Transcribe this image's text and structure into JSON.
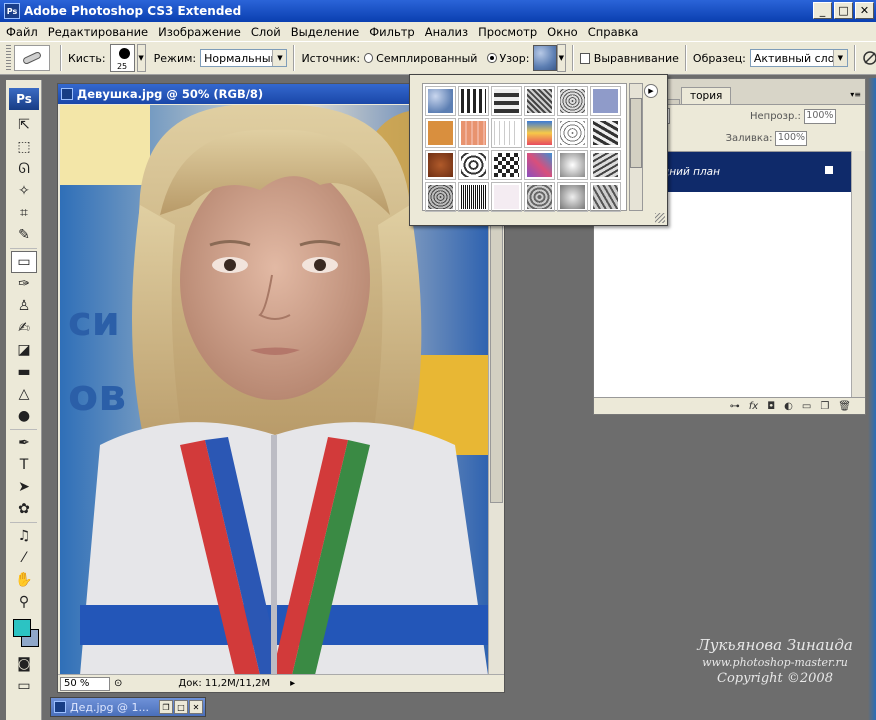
{
  "window": {
    "title": "Adobe Photoshop CS3 Extended",
    "app_icon": "Ps",
    "controls": [
      "_",
      "□",
      "✕"
    ]
  },
  "menu": [
    "Файл",
    "Редактирование",
    "Изображение",
    "Слой",
    "Выделение",
    "Фильтр",
    "Анализ",
    "Просмотр",
    "Окно",
    "Справка"
  ],
  "options": {
    "brush_label": "Кисть:",
    "brush_size": "25",
    "mode_label": "Режим:",
    "mode_value": "Нормальный",
    "source_label": "Источник:",
    "source_sampled": "Семплированный",
    "source_pattern": "Узор:",
    "aligned_label": "Выравнивание",
    "sample_label": "Образец:",
    "sample_value": "Активный слой"
  },
  "toolbox": {
    "logo": "Ps"
  },
  "document": {
    "title": "Девушка.jpg @ 50% (RGB/8)",
    "zoom": "50 %",
    "doc_info": "Док: 11,2M/11,2M"
  },
  "layers_panel": {
    "tab_history": "тория",
    "opacity_label": "Непрозр.:",
    "opacity_value": "100%",
    "fill_label": "Заливка:",
    "fill_value": "100%",
    "layer_name": "дний план"
  },
  "mini_doc": {
    "title": "Дед.jpg @ 1..."
  },
  "watermark": {
    "name": "Лукьянова Зинаида",
    "url": "www.photoshop-master.ru",
    "copyright": "Copyright ©2008"
  },
  "colors": {
    "foreground": "#2cc3c3",
    "background": "#8fa7c9",
    "title_bar": "#1a4fc4",
    "layer_selected": "#0f2a6a"
  }
}
